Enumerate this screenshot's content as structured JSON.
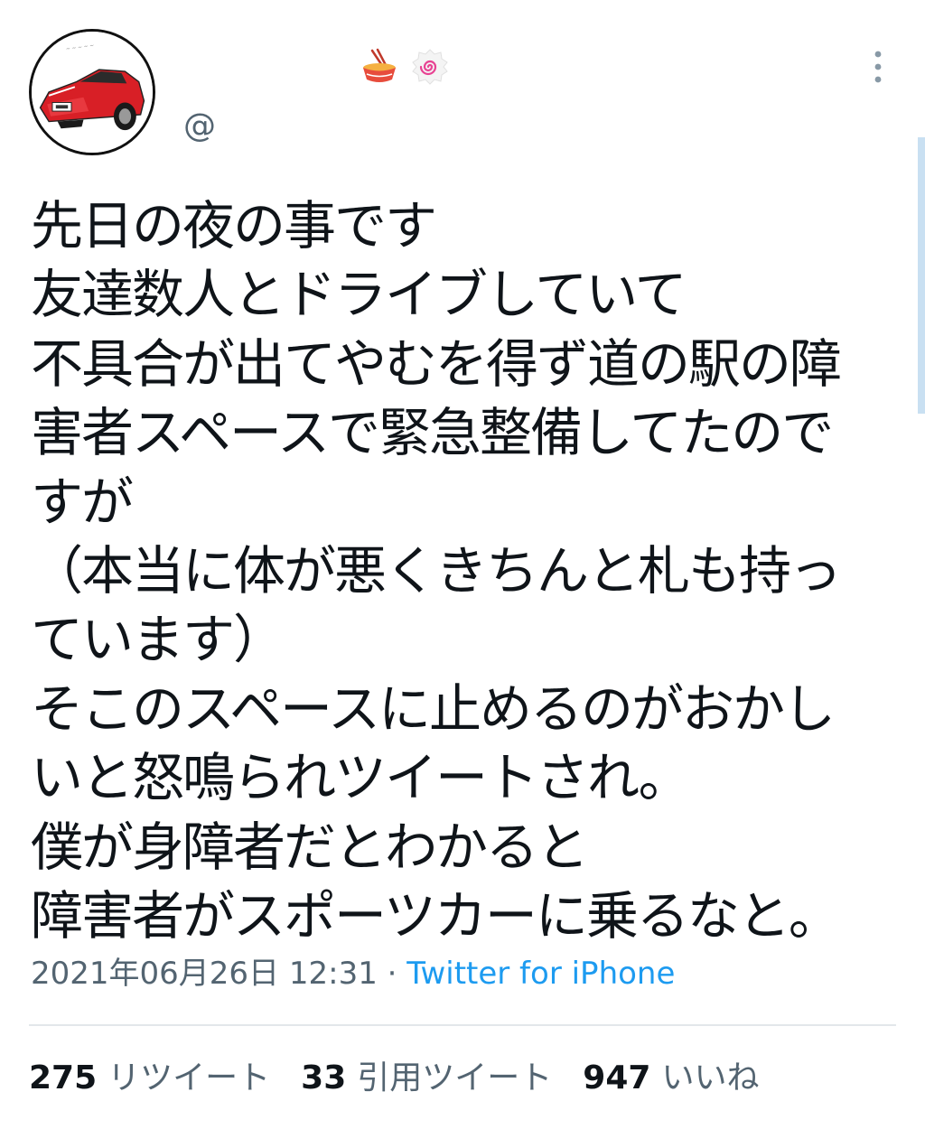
{
  "tweet": {
    "author": {
      "handle": "@",
      "display_name_icons": [
        "ramen-bowl-icon",
        "fish-cake-icon"
      ]
    },
    "text_lines": [
      "先日の夜の事です",
      "友達数人とドライブしていて",
      "不具合が出てやむを得ず道の駅の障",
      "害者スペースで緊急整備してたので",
      "すが",
      "（本当に体が悪くきちんと札も持っ",
      "ています）",
      "そこのスペースに止めるのがおかし",
      "いと怒鳴られツイートされ。",
      "僕が身障者だとわかると",
      "障害者がスポーツカーに乗るなと。"
    ],
    "timestamp": "2021年06月26日 12:31",
    "separator": " · ",
    "source": "Twitter for iPhone",
    "stats": [
      {
        "count": "275",
        "label": "リツイート"
      },
      {
        "count": "33",
        "label": "引用ツイート"
      },
      {
        "count": "947",
        "label": "いいね"
      }
    ]
  },
  "colors": {
    "text": "#0f1419",
    "secondary": "#536471",
    "link": "#1d9bf0",
    "divider": "#e3e7ea"
  }
}
